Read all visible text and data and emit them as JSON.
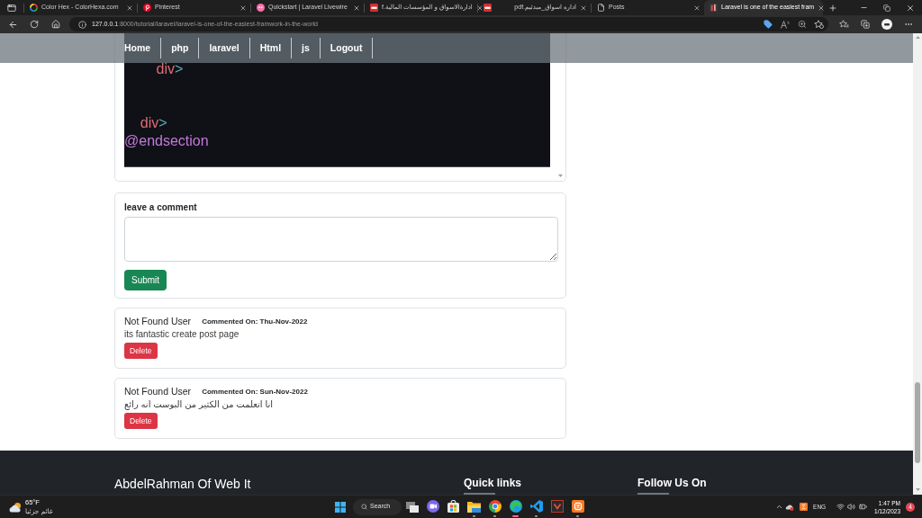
{
  "browser": {
    "tabs": [
      {
        "kind": "ring",
        "title": "Color Hex - ColorHexa.com",
        "selected": false
      },
      {
        "kind": "pin",
        "title": "Pinterest",
        "selected": false
      },
      {
        "kind": "blob",
        "title": "Quickstart | Laravel Livewire",
        "selected": false
      },
      {
        "kind": "pdf",
        "title": "ادارةالاسواق و المؤسسات المالية.f",
        "selected": false
      },
      {
        "kind": "pdf",
        "title": "اداره اسواق_مبدئيم.pdf",
        "selected": false
      },
      {
        "kind": "page",
        "title": "Posts",
        "selected": false
      },
      {
        "kind": "bars",
        "title": "Laravel is one of the easiest fram",
        "selected": true
      }
    ],
    "address_bar": {
      "host": "127.0.0.1",
      "path": ":8000/tutorial/laravel/laravel-is-one-of-the-easiest-framwork-in-the-world"
    }
  },
  "navbar": {
    "links": [
      "Home",
      "php",
      "laravel",
      "Html",
      "js",
      "Logout"
    ]
  },
  "code_block": {
    "lines": [
      {
        "kind": "code",
        "tokens": [
          {
            "kind": "tag",
            "text": "        div"
          },
          {
            "kind": "punct",
            "text": ">"
          }
        ]
      },
      {
        "kind": "blank"
      },
      {
        "kind": "blank"
      },
      {
        "kind": "code",
        "tokens": [
          {
            "kind": "tag",
            "text": "    div"
          },
          {
            "kind": "punct",
            "text": ">"
          }
        ]
      },
      {
        "kind": "code",
        "tokens": [
          {
            "kind": "directive",
            "text": "@endsection"
          }
        ]
      }
    ]
  },
  "comment_form": {
    "label": "leave a comment",
    "submit": "Submit"
  },
  "comments": [
    {
      "author": "Not Found User",
      "meta": "Commented On: Thu-Nov-2022",
      "body": "its fantastic create post page",
      "delete": "Delete"
    },
    {
      "author": "Not Found User",
      "meta": "Commented On: Sun-Nov-2022",
      "body": "انا اتعلمت من الكثير من البوست انه رائع",
      "delete": "Delete"
    }
  ],
  "footer": {
    "brand": "AbdelRahman Of Web It",
    "headings": [
      "Quick links",
      "Follow Us On"
    ]
  },
  "taskbar": {
    "weather": {
      "temperature": "65°F",
      "condition": "غائم جزئيا"
    },
    "search": "Search",
    "apps": [
      {
        "kind": "taskview",
        "running": false,
        "selected": false
      },
      {
        "kind": "chat",
        "running": false,
        "selected": false
      },
      {
        "kind": "store",
        "running": false,
        "selected": false
      },
      {
        "kind": "folder",
        "running": true,
        "selected": false
      },
      {
        "kind": "chrome",
        "running": true,
        "selected": false
      },
      {
        "kind": "edge",
        "running": true,
        "selected": true
      },
      {
        "kind": "code",
        "running": true,
        "selected": false
      },
      {
        "kind": "vapp",
        "running": false,
        "selected": false
      },
      {
        "kind": "xampp",
        "running": true,
        "selected": false
      }
    ],
    "tray": {
      "language": "ENG",
      "time": "1:47 PM",
      "date": "1/12/2023",
      "notifications": "4"
    }
  }
}
